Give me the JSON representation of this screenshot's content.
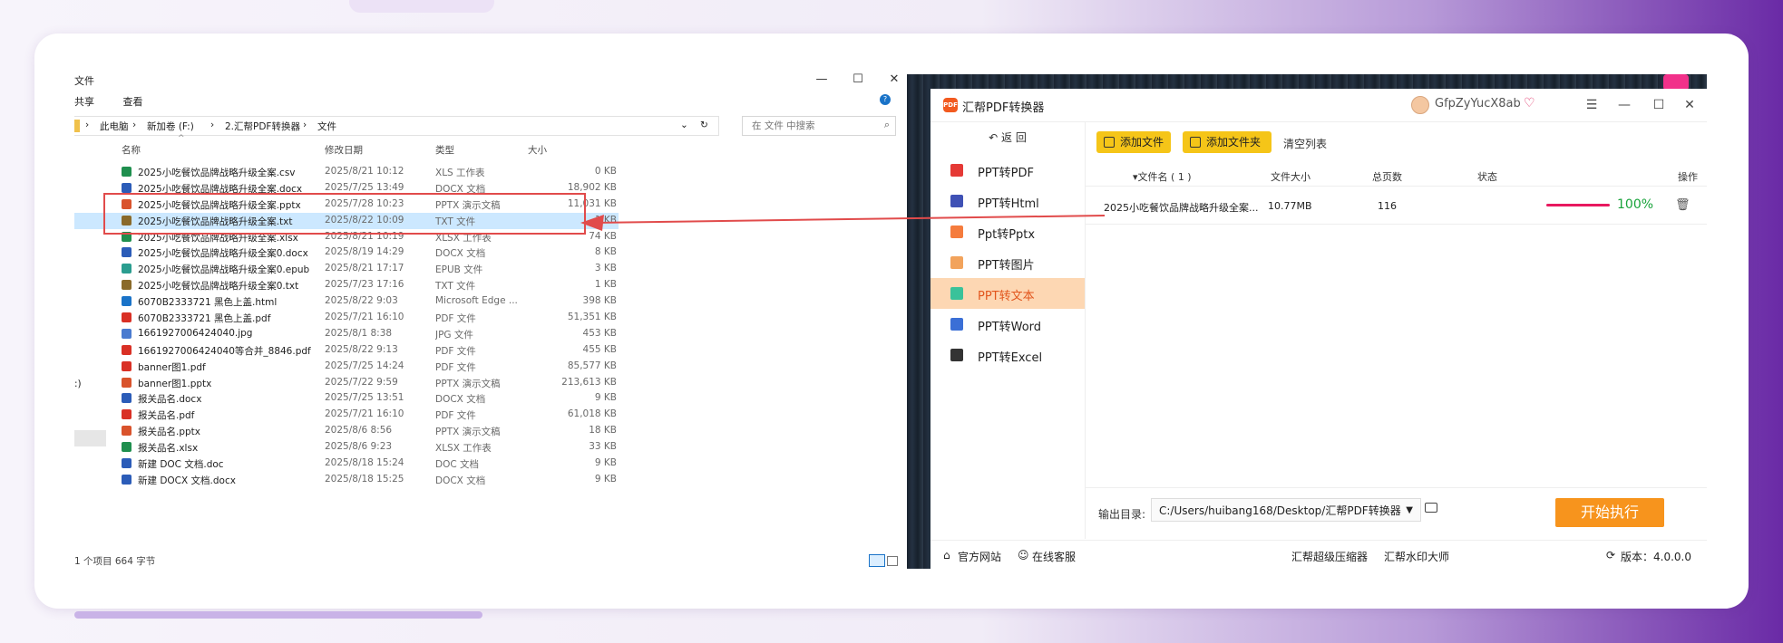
{
  "explorer": {
    "title_fragment": "文件",
    "window_controls": {
      "minimize": "—",
      "maximize": "☐",
      "close": "✕"
    },
    "menu": [
      "共享",
      "查看"
    ],
    "breadcrumb": [
      "此电脑",
      "新加卷 (F:)",
      "2.汇帮PDF转换器",
      "文件"
    ],
    "search_placeholder": "在 文件 中搜索",
    "columns": {
      "name": "名称",
      "date": "修改日期",
      "type": "类型",
      "size": "大小"
    },
    "files": [
      {
        "name": "2025小吃餐饮品牌战略升级全案.csv",
        "date": "2025/8/21 10:12",
        "type": "XLS 工作表",
        "size": "0 KB",
        "icon": "excel",
        "color": "#1f8f4e"
      },
      {
        "name": "2025小吃餐饮品牌战略升级全案.docx",
        "date": "2025/7/25 13:49",
        "type": "DOCX 文档",
        "size": "18,902 KB",
        "icon": "word",
        "color": "#2b5cb8"
      },
      {
        "name": "2025小吃餐饮品牌战略升级全案.pptx",
        "date": "2025/7/28 10:23",
        "type": "PPTX 演示文稿",
        "size": "11,031 KB",
        "icon": "powerpoint",
        "color": "#d9532c"
      },
      {
        "name": "2025小吃餐饮品牌战略升级全案.txt",
        "date": "2025/8/22 10:09",
        "type": "TXT 文件",
        "size": "1 KB",
        "icon": "text",
        "color": "#8a6a2a",
        "selected": true
      },
      {
        "name": "2025小吃餐饮品牌战略升级全案.xlsx",
        "date": "2025/8/21 10:19",
        "type": "XLSX 工作表",
        "size": "74 KB",
        "icon": "excel",
        "color": "#1f8f4e"
      },
      {
        "name": "2025小吃餐饮品牌战略升级全案0.docx",
        "date": "2025/8/19 14:29",
        "type": "DOCX 文档",
        "size": "8 KB",
        "icon": "word",
        "color": "#2b5cb8"
      },
      {
        "name": "2025小吃餐饮品牌战略升级全案0.epub",
        "date": "2025/8/21 17:17",
        "type": "EPUB 文件",
        "size": "3 KB",
        "icon": "epub",
        "color": "#2a9d8f"
      },
      {
        "name": "2025小吃餐饮品牌战略升级全案0.txt",
        "date": "2025/7/23 17:16",
        "type": "TXT 文件",
        "size": "1 KB",
        "icon": "text",
        "color": "#8a6a2a"
      },
      {
        "name": "6070B2333721 黑色上盖.html",
        "date": "2025/8/22 9:03",
        "type": "Microsoft Edge ...",
        "size": "398 KB",
        "icon": "edge",
        "color": "#1a73c8"
      },
      {
        "name": "6070B2333721 黑色上盖.pdf",
        "date": "2025/7/21 16:10",
        "type": "PDF 文件",
        "size": "51,351 KB",
        "icon": "pdf",
        "color": "#d93025"
      },
      {
        "name": "1661927006424040.jpg",
        "date": "2025/8/1 8:38",
        "type": "JPG 文件",
        "size": "453 KB",
        "icon": "image",
        "color": "#4a7bd0"
      },
      {
        "name": "1661927006424040等合并_8846.pdf",
        "date": "2025/8/22 9:13",
        "type": "PDF 文件",
        "size": "455 KB",
        "icon": "pdf",
        "color": "#d93025"
      },
      {
        "name": "banner图1.pdf",
        "date": "2025/7/25 14:24",
        "type": "PDF 文件",
        "size": "85,577 KB",
        "icon": "pdf",
        "color": "#d93025"
      },
      {
        "name": "banner图1.pptx",
        "date": "2025/7/22 9:59",
        "type": "PPTX 演示文稿",
        "size": "213,613 KB",
        "icon": "powerpoint",
        "color": "#d9532c"
      },
      {
        "name": "报关品名.docx",
        "date": "2025/7/25 13:51",
        "type": "DOCX 文档",
        "size": "9 KB",
        "icon": "word",
        "color": "#2b5cb8"
      },
      {
        "name": "报关品名.pdf",
        "date": "2025/7/21 16:10",
        "type": "PDF 文件",
        "size": "61,018 KB",
        "icon": "pdf",
        "color": "#d93025"
      },
      {
        "name": "报关品名.pptx",
        "date": "2025/8/6 8:56",
        "type": "PPTX 演示文稿",
        "size": "18 KB",
        "icon": "powerpoint",
        "color": "#d9532c"
      },
      {
        "name": "报关品名.xlsx",
        "date": "2025/8/6 9:23",
        "type": "XLSX 工作表",
        "size": "33 KB",
        "icon": "excel",
        "color": "#1f8f4e"
      },
      {
        "name": "新建 DOC 文档.doc",
        "date": "2025/8/18 15:24",
        "type": "DOC 文档",
        "size": "9 KB",
        "icon": "word",
        "color": "#2b5cb8"
      },
      {
        "name": "新建 DOCX 文档.docx",
        "date": "2025/8/18 15:25",
        "type": "DOCX 文档",
        "size": "9 KB",
        "icon": "word",
        "color": "#2b5cb8"
      }
    ],
    "status": "1 个项目  664 字节",
    "left_fragment": ":)"
  },
  "app": {
    "title": "汇帮PDF转换器",
    "logo_text": "PDF",
    "username": "GfpZyYucX8ab",
    "back_label": "返 回",
    "sidebar": [
      {
        "label": "PPT转PDF",
        "icon": "pdf-icon",
        "color": "#e53935"
      },
      {
        "label": "PPT转Html",
        "icon": "html-icon",
        "color": "#3f51b5"
      },
      {
        "label": "Ppt转Pptx",
        "icon": "pptx-icon",
        "color": "#f57c3d"
      },
      {
        "label": "PPT转图片",
        "icon": "image-icon",
        "color": "#f2a35c"
      },
      {
        "label": "PPT转文本",
        "icon": "text-icon",
        "color": "#3ac29a",
        "active": true
      },
      {
        "label": "PPT转Word",
        "icon": "word-icon",
        "color": "#3b6fd6"
      },
      {
        "label": "PPT转Excel",
        "icon": "excel-icon",
        "color": "#333333"
      }
    ],
    "toolbar": {
      "add_file": "添加文件",
      "add_folder": "添加文件夹",
      "clear_list": "清空列表"
    },
    "table": {
      "headers": {
        "name": "文件名 ( 1 )",
        "size": "文件大小",
        "pages": "总页数",
        "status": "状态",
        "action": "操作"
      },
      "rows": [
        {
          "name": "2025小吃餐饮品牌战略升级全案...",
          "size": "10.77MB",
          "pages": "116",
          "progress_pct": 100,
          "percent_text": "100%"
        }
      ]
    },
    "output": {
      "label": "输出目录:",
      "path": "C:/Users/huibang168/Desktop/汇帮PDF转换器"
    },
    "start_button": "开始执行",
    "footer": {
      "site": "官方网站",
      "service": "在线客服",
      "compressor": "汇帮超级压缩器",
      "watermark": "汇帮水印大师",
      "version": "版本：4.0.0.0"
    },
    "colors": {
      "accent": "#f7941d",
      "yellow": "#f5c518",
      "active_bg": "#fdd7b3",
      "active_text": "#e2561d",
      "progress": "#e8195f",
      "percent": "#19a33b"
    }
  }
}
